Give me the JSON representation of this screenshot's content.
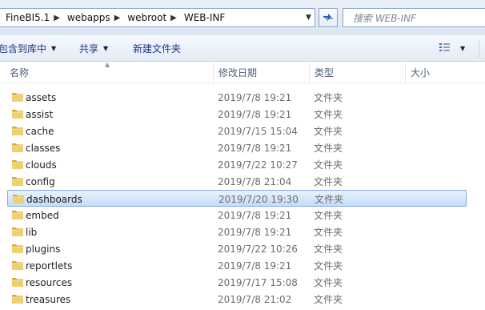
{
  "address": {
    "crumbs": [
      "FineBI5.1",
      "webapps",
      "webroot",
      "WEB-INF"
    ]
  },
  "search": {
    "placeholder": "搜索 WEB-INF"
  },
  "toolbar": {
    "include_library": "包含到库中",
    "share": "共享",
    "new_folder": "新建文件夹"
  },
  "columns": {
    "name": "名称",
    "modified": "修改日期",
    "type": "类型",
    "size": "大小"
  },
  "files": [
    {
      "name": "assets",
      "modified": "2019/7/8 19:21",
      "type": "文件夹"
    },
    {
      "name": "assist",
      "modified": "2019/7/8 19:21",
      "type": "文件夹"
    },
    {
      "name": "cache",
      "modified": "2019/7/15 15:04",
      "type": "文件夹"
    },
    {
      "name": "classes",
      "modified": "2019/7/8 19:21",
      "type": "文件夹"
    },
    {
      "name": "clouds",
      "modified": "2019/7/22 10:27",
      "type": "文件夹"
    },
    {
      "name": "config",
      "modified": "2019/7/8 21:04",
      "type": "文件夹"
    },
    {
      "name": "dashboards",
      "modified": "2019/7/20 19:30",
      "type": "文件夹",
      "selected": true
    },
    {
      "name": "embed",
      "modified": "2019/7/8 19:21",
      "type": "文件夹"
    },
    {
      "name": "lib",
      "modified": "2019/7/8 19:21",
      "type": "文件夹"
    },
    {
      "name": "plugins",
      "modified": "2019/7/22 10:26",
      "type": "文件夹"
    },
    {
      "name": "reportlets",
      "modified": "2019/7/8 19:21",
      "type": "文件夹"
    },
    {
      "name": "resources",
      "modified": "2019/7/17 15:08",
      "type": "文件夹"
    },
    {
      "name": "treasures",
      "modified": "2019/7/8 21:02",
      "type": "文件夹"
    }
  ],
  "icons": {
    "folder": "folder-icon",
    "refresh": "refresh-icon",
    "view": "view-options-icon",
    "breadcrumb_separator": "chevron-right-icon"
  },
  "colors": {
    "selection_fill": "#cce0f8",
    "selection_border": "#84acdd",
    "folder": "#e8c25a"
  }
}
